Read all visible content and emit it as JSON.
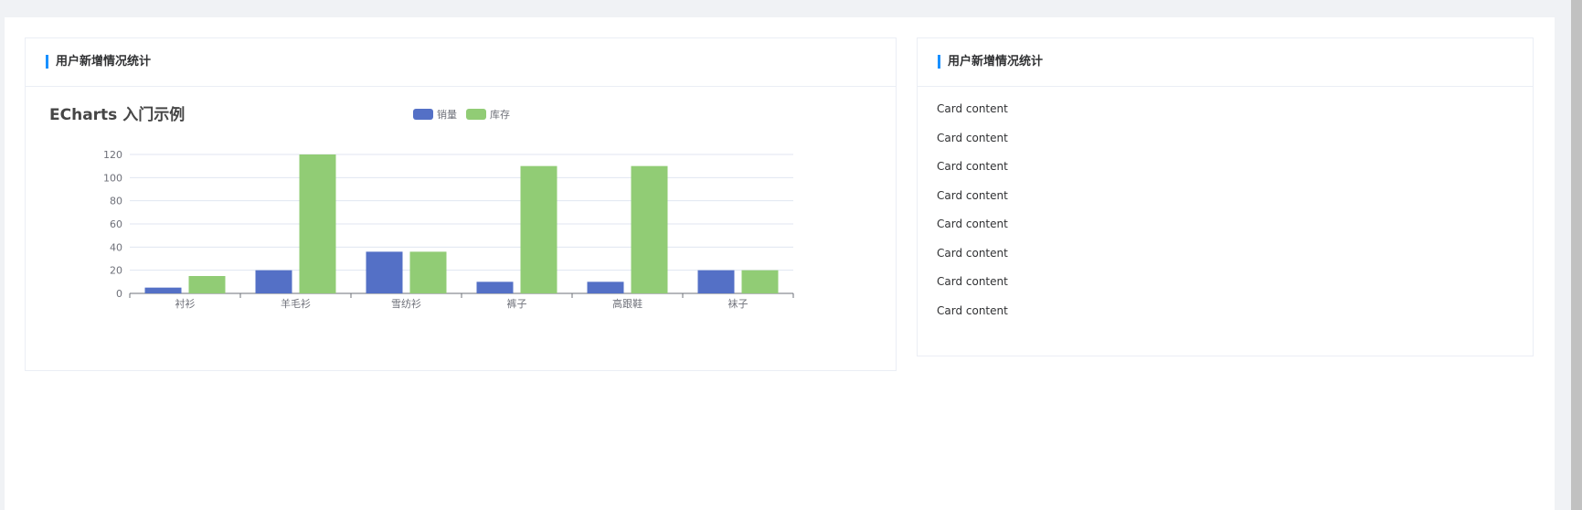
{
  "left_card": {
    "title": "用户新增情况统计"
  },
  "right_card": {
    "title": "用户新增情况统计",
    "items": [
      "Card content",
      "Card content",
      "Card content",
      "Card content",
      "Card content",
      "Card content",
      "Card content",
      "Card content"
    ]
  },
  "colors": {
    "accent": "#1890ff",
    "series_sales": "#5470c6",
    "series_stock": "#91cc75"
  },
  "chart_data": {
    "type": "bar",
    "title": "ECharts 入门示例",
    "categories": [
      "衬衫",
      "羊毛衫",
      "雪纺衫",
      "裤子",
      "高跟鞋",
      "袜子"
    ],
    "series": [
      {
        "name": "销量",
        "values": [
          5,
          20,
          36,
          10,
          10,
          20
        ]
      },
      {
        "name": "库存",
        "values": [
          15,
          120,
          36,
          110,
          110,
          20
        ]
      }
    ],
    "y_ticks": [
      0,
      20,
      40,
      60,
      80,
      100,
      120
    ],
    "ylim": [
      0,
      120
    ],
    "grid": true,
    "legend_position": "top-center"
  }
}
